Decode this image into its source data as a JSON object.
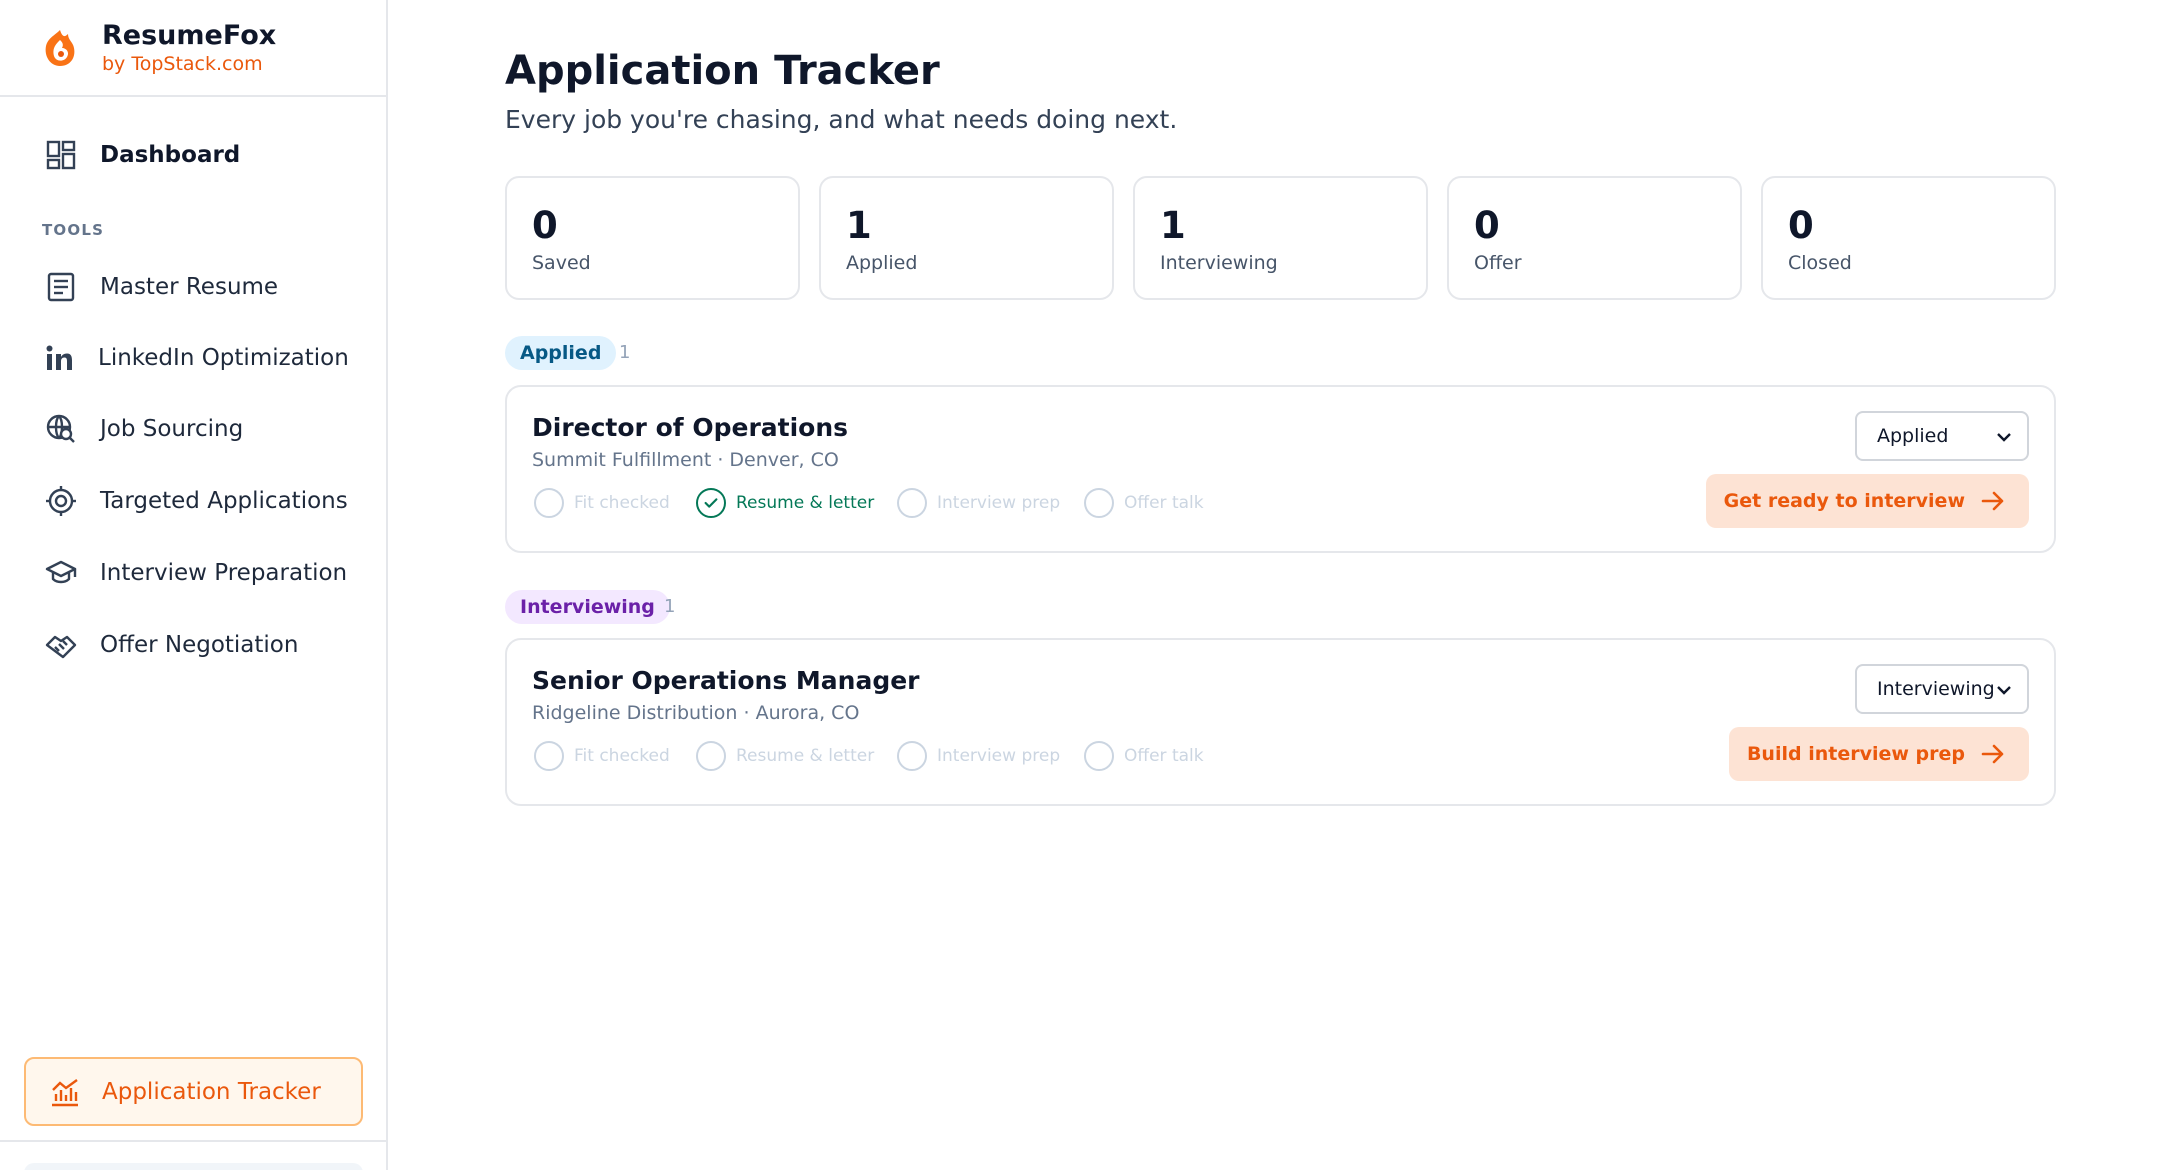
{
  "brand": {
    "name": "ResumeFox",
    "sub": "by TopStack.com"
  },
  "sidebar": {
    "dashboard": "Dashboard",
    "section_title": "TOOLS",
    "items": [
      {
        "label": "Master Resume",
        "icon": "document-icon"
      },
      {
        "label": "LinkedIn Optimization",
        "icon": "linkedin-icon"
      },
      {
        "label": "Job Sourcing",
        "icon": "globe-search-icon"
      },
      {
        "label": "Targeted Applications",
        "icon": "target-icon"
      },
      {
        "label": "Interview Preparation",
        "icon": "graduation-cap-icon"
      },
      {
        "label": "Offer Negotiation",
        "icon": "handshake-icon"
      }
    ],
    "active": {
      "label": "Application Tracker",
      "icon": "chart-icon"
    }
  },
  "page": {
    "title": "Application Tracker",
    "subtitle": "Every job you're chasing, and what needs doing next."
  },
  "stats": [
    {
      "value": "0",
      "label": "Saved"
    },
    {
      "value": "1",
      "label": "Applied"
    },
    {
      "value": "1",
      "label": "Interviewing"
    },
    {
      "value": "0",
      "label": "Offer"
    },
    {
      "value": "0",
      "label": "Closed"
    }
  ],
  "groups": [
    {
      "name": "Applied",
      "count": "1",
      "badge_bg": "#e0f2fe",
      "badge_color": "#075985",
      "jobs": [
        {
          "title": "Director of Operations",
          "meta": "Summit Fulfillment · Denver, CO",
          "status": "Applied",
          "action": "Get ready to interview",
          "steps": [
            {
              "label": "Fit checked",
              "done": false
            },
            {
              "label": "Resume & letter",
              "done": true
            },
            {
              "label": "Interview prep",
              "done": false
            },
            {
              "label": "Offer talk",
              "done": false
            }
          ]
        }
      ]
    },
    {
      "name": "Interviewing",
      "count": "1",
      "badge_bg": "#f3e8ff",
      "badge_color": "#6b21a8",
      "jobs": [
        {
          "title": "Senior Operations Manager",
          "meta": "Ridgeline Distribution · Aurora, CO",
          "status": "Interviewing",
          "action": "Build interview prep",
          "steps": [
            {
              "label": "Fit checked",
              "done": false
            },
            {
              "label": "Resume & letter",
              "done": false
            },
            {
              "label": "Interview prep",
              "done": false
            },
            {
              "label": "Offer talk",
              "done": false
            }
          ]
        }
      ]
    }
  ],
  "colors": {
    "accent": "#ea580c",
    "done": "#047857",
    "muted": "#cbd5e1"
  }
}
